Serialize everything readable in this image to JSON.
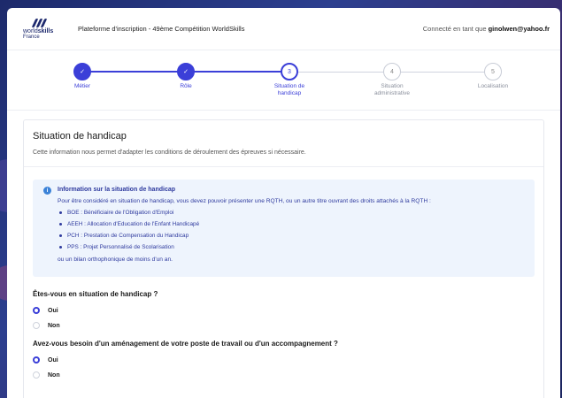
{
  "header": {
    "logo_world": "world",
    "logo_skills": "skills",
    "logo_country": "France",
    "title": "Plateforme d'inscription - 49ème Compétition WorldSkills",
    "user_prefix": "Connecté en tant que",
    "user_email": "ginolwen@yahoo.fr"
  },
  "stepper": {
    "steps": [
      {
        "number": "1",
        "label": "Métier",
        "state": "done"
      },
      {
        "number": "2",
        "label": "Rôle",
        "state": "done"
      },
      {
        "number": "3",
        "label_line1": "Situation de",
        "label_line2": "handicap",
        "state": "current"
      },
      {
        "number": "4",
        "label_line1": "Situation",
        "label_line2": "administrative",
        "state": "todo"
      },
      {
        "number": "5",
        "label": "Localisation",
        "state": "todo"
      }
    ]
  },
  "section": {
    "title": "Situation de handicap",
    "subtitle": "Cette information nous permet d'adapter les conditions de déroulement des épreuves si nécessaire."
  },
  "info": {
    "title": "Information sur la situation de handicap",
    "intro": "Pour être considéré en situation de handicap, vous devez pouvoir présenter une RQTH, ou un autre titre ouvrant des droits attachés à la RQTH :",
    "items": [
      "BOE : Bénéficiaire de l'Obligation d'Emploi",
      "AEEH : Allocation d'Education de l'Enfant Handicapé",
      "PCH : Prestation de Compensation du Handicap",
      "PPS : Projet Personnalisé de Scolarisation"
    ],
    "footer": "ou un bilan orthophonique de moins d'un an."
  },
  "questions": [
    {
      "label": "Êtes-vous en situation de handicap ?",
      "options": [
        "Oui",
        "Non"
      ],
      "selected": "Oui"
    },
    {
      "label": "Avez-vous besoin d'un aménagement de votre poste de travail ou d'un accompagnement ?",
      "options": [
        "Oui",
        "Non"
      ],
      "selected": "Oui"
    }
  ],
  "colors": {
    "accent": "#3b3fd8",
    "info_bg": "#eef4fd",
    "info_text": "#2e3a9e"
  }
}
